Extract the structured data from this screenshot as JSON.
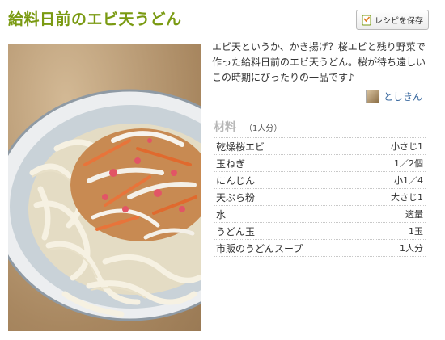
{
  "recipe": {
    "title": "給料日前のエビ天うどん",
    "save_label": "レシピを保存",
    "description": "エビ天というか、かき揚げ？桜エビと残り野菜で作った給料日前のエビ天うどん。桜が待ち遠しいこの時期にぴったりの一品です♪",
    "author": "としきん",
    "ingredients_title": "材料",
    "servings": "（1人分）",
    "ingredients": [
      {
        "name": "乾燥桜エビ",
        "qty": "小さじ1"
      },
      {
        "name": "玉ねぎ",
        "qty": "1／2個"
      },
      {
        "name": "にんじん",
        "qty": "小1／4"
      },
      {
        "name": "天ぷら粉",
        "qty": "大さじ1"
      },
      {
        "name": "水",
        "qty": "適量"
      },
      {
        "name": "うどん玉",
        "qty": "1玉"
      },
      {
        "name": "市販のうどんスープ",
        "qty": "1人分"
      }
    ]
  },
  "colors": {
    "title": "#7a9a12",
    "author_link": "#3b6aa0",
    "ingredients_title": "#b7b7b7"
  },
  "icons": {
    "save_button": "bookmark-icon"
  }
}
